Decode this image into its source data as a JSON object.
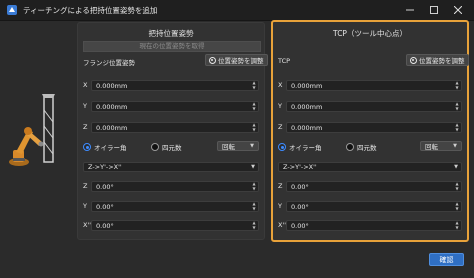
{
  "window": {
    "title": "ティーチングによる把持位置姿勢を追加",
    "icons": {
      "app": "app-logo-icon",
      "minimize": "minimize-icon",
      "maximize": "maximize-icon",
      "close": "close-icon"
    }
  },
  "left_panel": {
    "title": "把持位置姿勢",
    "current_pose_button": "現在の位置姿勢を取得",
    "flange_label": "フランジ位置姿勢",
    "adjust_button": "位置姿勢を調整",
    "position": {
      "x": "0.000mm",
      "y": "0.000mm",
      "z": "0.000mm"
    },
    "euler_label": "オイラー角",
    "quaternion_label": "四元数",
    "rotate_button": "回転",
    "convention": "Z->Y'->X''",
    "rotation": {
      "z": "0.00°",
      "y": "0.00°",
      "x": "0.00°"
    }
  },
  "right_panel": {
    "title": "TCP（ツール中心点）",
    "tcp_label": "TCP",
    "adjust_button": "位置姿勢を調整",
    "position": {
      "x": "0.000mm",
      "y": "0.000mm",
      "z": "0.000mm"
    },
    "euler_label": "オイラー角",
    "quaternion_label": "四元数",
    "rotate_button": "回転",
    "convention": "Z->Y'->X''",
    "rotation": {
      "z": "0.00°",
      "y": "0.00°",
      "x": "0.00°"
    }
  },
  "axes": {
    "x": "X",
    "y": "Y",
    "z": "Z",
    "rz": "Z",
    "ry": "Y",
    "rx": "X''"
  },
  "footer": {
    "confirm_button": "確認"
  },
  "colors": {
    "accent": "#e8a23a",
    "primary_button": "#2f6fc4",
    "radio_selected": "#3d8bff"
  }
}
